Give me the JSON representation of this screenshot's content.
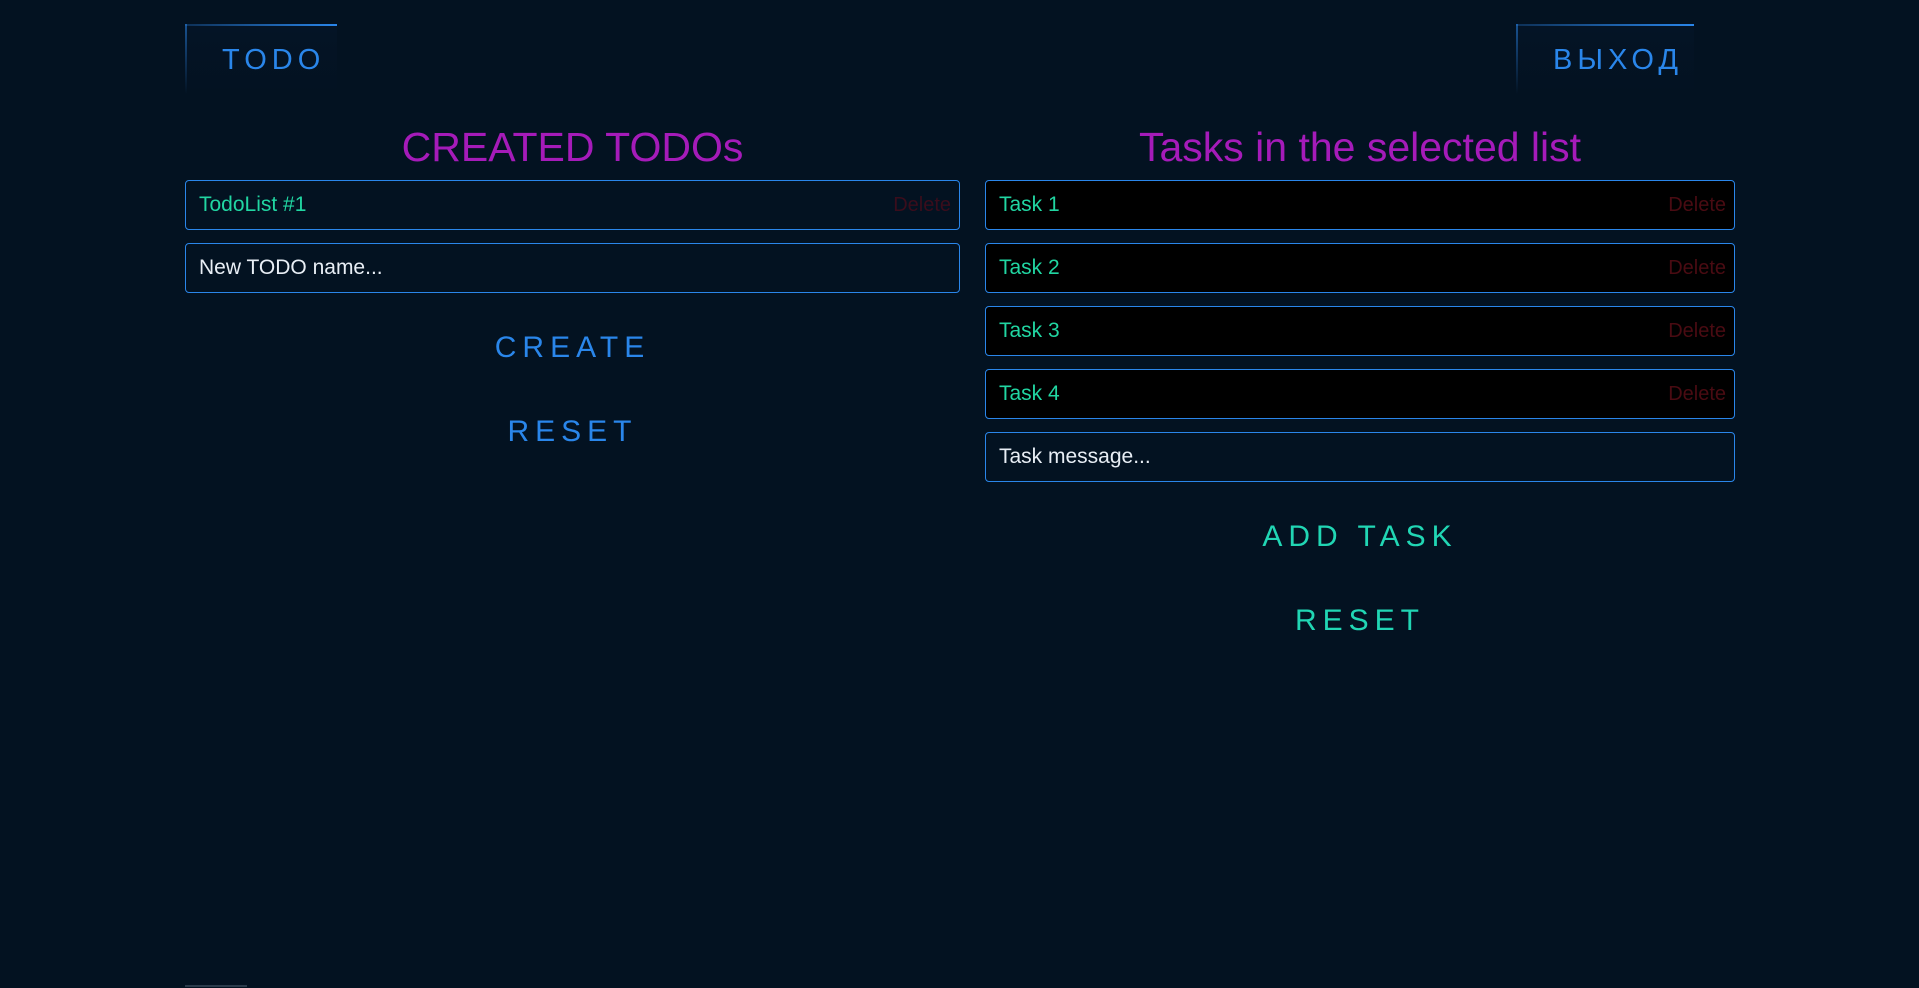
{
  "header": {
    "todo_label": "TODO",
    "exit_label": "ВЫХОД"
  },
  "todos": {
    "title": "CREATED TODOs",
    "items": [
      {
        "label": "TodoList #1",
        "delete_label": "Delete"
      }
    ],
    "input_placeholder": "New TODO name...",
    "create_label": "CREATE",
    "reset_label": "RESET"
  },
  "tasks": {
    "title": "Tasks in the selected list",
    "items": [
      {
        "label": "Task 1",
        "delete_label": "Delete"
      },
      {
        "label": "Task 2",
        "delete_label": "Delete"
      },
      {
        "label": "Task 3",
        "delete_label": "Delete"
      },
      {
        "label": "Task 4",
        "delete_label": "Delete"
      }
    ],
    "input_placeholder": "Task message...",
    "add_label": "ADD TASK",
    "reset_label": "RESET"
  },
  "colors": {
    "background": "#031221",
    "accent_blue": "#2a86ea",
    "title_purple": "#a51bb9",
    "item_text_green": "#21d6a2",
    "delete_red": "#4a0b12"
  }
}
